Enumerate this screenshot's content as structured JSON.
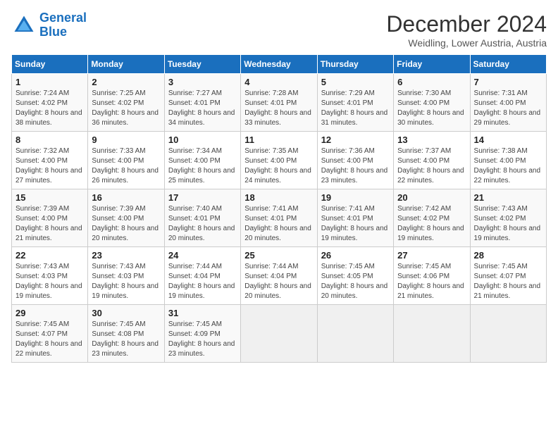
{
  "header": {
    "logo_line1": "General",
    "logo_line2": "Blue",
    "month": "December 2024",
    "location": "Weidling, Lower Austria, Austria"
  },
  "weekdays": [
    "Sunday",
    "Monday",
    "Tuesday",
    "Wednesday",
    "Thursday",
    "Friday",
    "Saturday"
  ],
  "weeks": [
    [
      {
        "day": "1",
        "sunrise": "7:24 AM",
        "sunset": "4:02 PM",
        "daylight": "8 hours and 38 minutes."
      },
      {
        "day": "2",
        "sunrise": "7:25 AM",
        "sunset": "4:02 PM",
        "daylight": "8 hours and 36 minutes."
      },
      {
        "day": "3",
        "sunrise": "7:27 AM",
        "sunset": "4:01 PM",
        "daylight": "8 hours and 34 minutes."
      },
      {
        "day": "4",
        "sunrise": "7:28 AM",
        "sunset": "4:01 PM",
        "daylight": "8 hours and 33 minutes."
      },
      {
        "day": "5",
        "sunrise": "7:29 AM",
        "sunset": "4:01 PM",
        "daylight": "8 hours and 31 minutes."
      },
      {
        "day": "6",
        "sunrise": "7:30 AM",
        "sunset": "4:00 PM",
        "daylight": "8 hours and 30 minutes."
      },
      {
        "day": "7",
        "sunrise": "7:31 AM",
        "sunset": "4:00 PM",
        "daylight": "8 hours and 29 minutes."
      }
    ],
    [
      {
        "day": "8",
        "sunrise": "7:32 AM",
        "sunset": "4:00 PM",
        "daylight": "8 hours and 27 minutes."
      },
      {
        "day": "9",
        "sunrise": "7:33 AM",
        "sunset": "4:00 PM",
        "daylight": "8 hours and 26 minutes."
      },
      {
        "day": "10",
        "sunrise": "7:34 AM",
        "sunset": "4:00 PM",
        "daylight": "8 hours and 25 minutes."
      },
      {
        "day": "11",
        "sunrise": "7:35 AM",
        "sunset": "4:00 PM",
        "daylight": "8 hours and 24 minutes."
      },
      {
        "day": "12",
        "sunrise": "7:36 AM",
        "sunset": "4:00 PM",
        "daylight": "8 hours and 23 minutes."
      },
      {
        "day": "13",
        "sunrise": "7:37 AM",
        "sunset": "4:00 PM",
        "daylight": "8 hours and 22 minutes."
      },
      {
        "day": "14",
        "sunrise": "7:38 AM",
        "sunset": "4:00 PM",
        "daylight": "8 hours and 22 minutes."
      }
    ],
    [
      {
        "day": "15",
        "sunrise": "7:39 AM",
        "sunset": "4:00 PM",
        "daylight": "8 hours and 21 minutes."
      },
      {
        "day": "16",
        "sunrise": "7:39 AM",
        "sunset": "4:00 PM",
        "daylight": "8 hours and 20 minutes."
      },
      {
        "day": "17",
        "sunrise": "7:40 AM",
        "sunset": "4:01 PM",
        "daylight": "8 hours and 20 minutes."
      },
      {
        "day": "18",
        "sunrise": "7:41 AM",
        "sunset": "4:01 PM",
        "daylight": "8 hours and 20 minutes."
      },
      {
        "day": "19",
        "sunrise": "7:41 AM",
        "sunset": "4:01 PM",
        "daylight": "8 hours and 19 minutes."
      },
      {
        "day": "20",
        "sunrise": "7:42 AM",
        "sunset": "4:02 PM",
        "daylight": "8 hours and 19 minutes."
      },
      {
        "day": "21",
        "sunrise": "7:43 AM",
        "sunset": "4:02 PM",
        "daylight": "8 hours and 19 minutes."
      }
    ],
    [
      {
        "day": "22",
        "sunrise": "7:43 AM",
        "sunset": "4:03 PM",
        "daylight": "8 hours and 19 minutes."
      },
      {
        "day": "23",
        "sunrise": "7:43 AM",
        "sunset": "4:03 PM",
        "daylight": "8 hours and 19 minutes."
      },
      {
        "day": "24",
        "sunrise": "7:44 AM",
        "sunset": "4:04 PM",
        "daylight": "8 hours and 19 minutes."
      },
      {
        "day": "25",
        "sunrise": "7:44 AM",
        "sunset": "4:04 PM",
        "daylight": "8 hours and 20 minutes."
      },
      {
        "day": "26",
        "sunrise": "7:45 AM",
        "sunset": "4:05 PM",
        "daylight": "8 hours and 20 minutes."
      },
      {
        "day": "27",
        "sunrise": "7:45 AM",
        "sunset": "4:06 PM",
        "daylight": "8 hours and 21 minutes."
      },
      {
        "day": "28",
        "sunrise": "7:45 AM",
        "sunset": "4:07 PM",
        "daylight": "8 hours and 21 minutes."
      }
    ],
    [
      {
        "day": "29",
        "sunrise": "7:45 AM",
        "sunset": "4:07 PM",
        "daylight": "8 hours and 22 minutes."
      },
      {
        "day": "30",
        "sunrise": "7:45 AM",
        "sunset": "4:08 PM",
        "daylight": "8 hours and 23 minutes."
      },
      {
        "day": "31",
        "sunrise": "7:45 AM",
        "sunset": "4:09 PM",
        "daylight": "8 hours and 23 minutes."
      },
      null,
      null,
      null,
      null
    ]
  ]
}
